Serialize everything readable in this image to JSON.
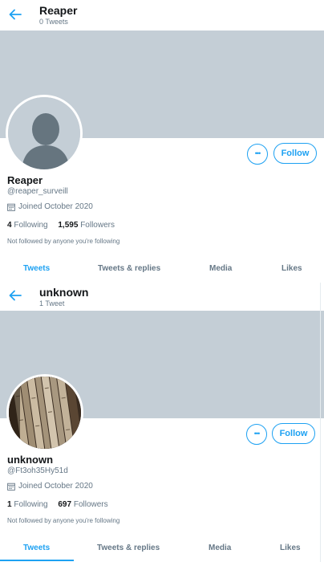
{
  "profiles": [
    {
      "name": "Reaper",
      "tweet_count": "0 Tweets",
      "handle": "@reaper_surveill",
      "joined": "Joined October 2020",
      "following_count": "4",
      "following_label": "Following",
      "followers_count": "1,595",
      "followers_label": "Followers",
      "not_followed": "Not followed by anyone you're following",
      "more_label": "•••",
      "follow_label": "Follow",
      "avatar": "default-avatar-silhouette",
      "tabs": [
        {
          "label": "Tweets",
          "active": true
        },
        {
          "label": "Tweets & replies",
          "active": false
        },
        {
          "label": "Media",
          "active": false
        },
        {
          "label": "Likes",
          "active": false
        }
      ]
    },
    {
      "name": "unknown",
      "tweet_count": "1 Tweet",
      "handle": "@Ft3oh35Hy51d",
      "joined": "Joined October 2020",
      "following_count": "1",
      "following_label": "Following",
      "followers_count": "697",
      "followers_label": "Followers",
      "not_followed": "Not followed by anyone you're following",
      "more_label": "•••",
      "follow_label": "Follow",
      "avatar": "photo-of-old-bound-books",
      "tabs": [
        {
          "label": "Tweets",
          "active": true
        },
        {
          "label": "Tweets & replies",
          "active": false
        },
        {
          "label": "Media",
          "active": false
        },
        {
          "label": "Likes",
          "active": false
        }
      ]
    }
  ],
  "colors": {
    "accent": "#1da1f2",
    "banner": "#c4ced6",
    "secondary_text": "#657786",
    "primary_text": "#14171a"
  }
}
